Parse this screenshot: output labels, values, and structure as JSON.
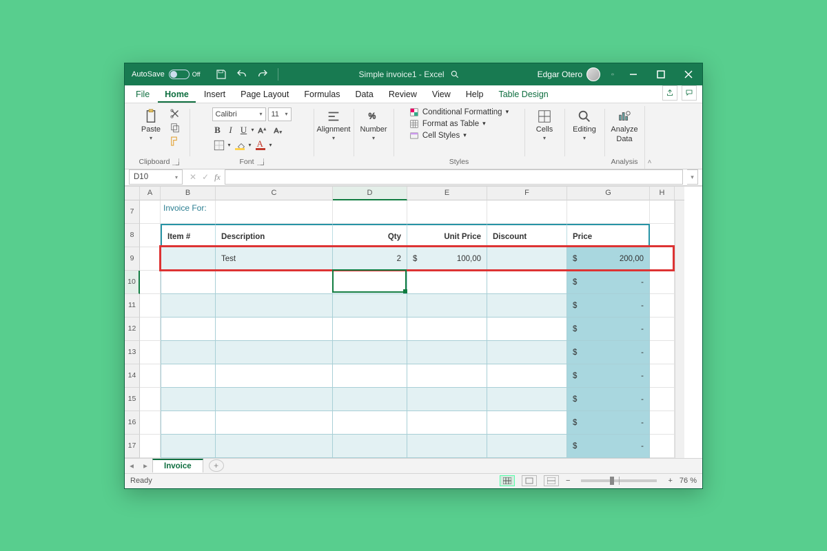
{
  "titlebar": {
    "autosave_label": "AutoSave",
    "autosave_state": "Off",
    "doc_title": "Simple invoice1  -  Excel",
    "user_name": "Edgar Otero"
  },
  "tabs": {
    "file": "File",
    "home": "Home",
    "insert": "Insert",
    "page_layout": "Page Layout",
    "formulas": "Formulas",
    "data": "Data",
    "review": "Review",
    "view": "View",
    "help": "Help",
    "table_design": "Table Design"
  },
  "ribbon": {
    "clipboard": {
      "label": "Clipboard",
      "paste": "Paste"
    },
    "font": {
      "label": "Font",
      "name": "Calibri",
      "size": "11"
    },
    "alignment": {
      "label": "Alignment",
      "btn": "Alignment"
    },
    "number": {
      "label": "Number",
      "btn": "Number"
    },
    "styles": {
      "label": "Styles",
      "cond": "Conditional Formatting",
      "fat": "Format as Table",
      "cell": "Cell Styles"
    },
    "cells": {
      "label": "Cells",
      "btn": "Cells"
    },
    "editing": {
      "label": "Editing",
      "btn": "Editing"
    },
    "analysis": {
      "label": "Analysis",
      "btn1": "Analyze",
      "btn2": "Data"
    }
  },
  "formula_bar": {
    "namebox": "D10",
    "fx": "fx",
    "value": ""
  },
  "columns": [
    "A",
    "B",
    "C",
    "D",
    "E",
    "F",
    "G",
    "H"
  ],
  "selected_column": "D",
  "row_headers": [
    "7",
    "8",
    "9",
    "10",
    "11",
    "12",
    "13",
    "14",
    "15",
    "16",
    "17"
  ],
  "selected_row": "10",
  "invoice": {
    "for_label": "Invoice For:",
    "headers": {
      "item": "Item #",
      "desc": "Description",
      "qty": "Qty",
      "unit": "Unit Price",
      "disc": "Discount",
      "price": "Price"
    },
    "row9": {
      "item": "",
      "desc": "Test",
      "qty": "2",
      "unit_sym": "$",
      "unit_val": "100,00",
      "disc": "",
      "price_sym": "$",
      "price_val": "200,00"
    },
    "empty_price_sym": "$",
    "empty_price_dash": "-"
  },
  "sheet_tab": "Invoice",
  "status": {
    "ready": "Ready",
    "zoom": "76 %"
  }
}
